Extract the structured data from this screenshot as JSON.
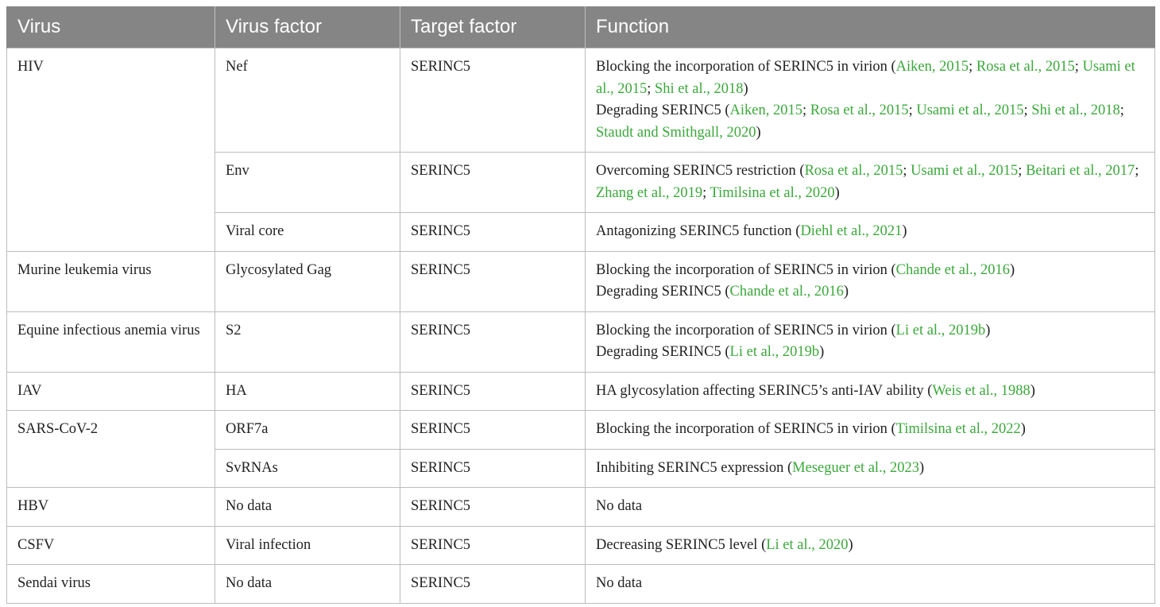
{
  "table": {
    "headers": [
      "Virus",
      "Virus factor",
      "Target factor",
      "Function"
    ],
    "rows": [
      {
        "virus": "HIV",
        "factor": "Nef",
        "target": "SERINC5",
        "function_lines": [
          [
            "Blocking the incorporation of SERINC5 in virion (",
            {
              "cite": "Aiken, 2015"
            },
            "; ",
            {
              "cite": "Rosa et al., 2015"
            },
            "; ",
            {
              "cite": "Usami et al., 2015"
            },
            "; ",
            {
              "cite": "Shi et al., 2018"
            },
            ")"
          ],
          [
            "Degrading SERINC5 (",
            {
              "cite": "Aiken, 2015"
            },
            "; ",
            {
              "cite": "Rosa et al., 2015"
            },
            "; ",
            {
              "cite": "Usami et al., 2015"
            },
            "; ",
            {
              "cite": "Shi et al., 2018"
            },
            "; ",
            {
              "cite": "Staudt and Smithgall, 2020"
            },
            ")"
          ]
        ]
      },
      {
        "virus": "",
        "factor": "Env",
        "target": "SERINC5",
        "function_lines": [
          [
            "Overcoming SERINC5 restriction (",
            {
              "cite": "Rosa et al., 2015"
            },
            "; ",
            {
              "cite": "Usami et al., 2015"
            },
            "; ",
            {
              "cite": "Beitari et al., 2017"
            },
            "; ",
            {
              "cite": "Zhang et al., 2019"
            },
            "; ",
            {
              "cite": "Timilsina et al., 2020"
            },
            ")"
          ]
        ]
      },
      {
        "virus": "",
        "factor": "Viral core",
        "target": "SERINC5",
        "function_lines": [
          [
            "Antagonizing SERINC5 function (",
            {
              "cite": "Diehl et al., 2021"
            },
            ")"
          ]
        ]
      },
      {
        "virus": "Murine leukemia virus",
        "factor": "Glycosylated Gag",
        "target": "SERINC5",
        "function_lines": [
          [
            "Blocking the incorporation of SERINC5 in virion (",
            {
              "cite": "Chande et al., 2016"
            },
            ")"
          ],
          [
            "Degrading SERINC5 (",
            {
              "cite": "Chande et al., 2016"
            },
            ")"
          ]
        ]
      },
      {
        "virus": "Equine infectious anemia virus",
        "factor": "S2",
        "target": "SERINC5",
        "function_lines": [
          [
            "Blocking the incorporation of SERINC5 in virion (",
            {
              "cite": "Li et al., 2019b"
            },
            ")"
          ],
          [
            "Degrading SERINC5 (",
            {
              "cite": "Li et al., 2019b"
            },
            ")"
          ]
        ]
      },
      {
        "virus": "IAV",
        "factor": "HA",
        "target": "SERINC5",
        "function_lines": [
          [
            "HA glycosylation affecting SERINC5’s anti-IAV ability (",
            {
              "cite": "Weis et al., 1988"
            },
            ")"
          ]
        ]
      },
      {
        "virus": "SARS-CoV-2",
        "factor": "ORF7a",
        "target": "SERINC5",
        "function_lines": [
          [
            "Blocking the incorporation of SERINC5 in virion (",
            {
              "cite": "Timilsina et al., 2022"
            },
            ")"
          ]
        ]
      },
      {
        "virus": "",
        "factor": "SvRNAs",
        "target": "SERINC5",
        "function_lines": [
          [
            "Inhibiting SERINC5 expression (",
            {
              "cite": "Meseguer et al., 2023"
            },
            ")"
          ]
        ]
      },
      {
        "virus": "HBV",
        "factor": "No data",
        "target": "SERINC5",
        "function_lines": [
          [
            "No data"
          ]
        ]
      },
      {
        "virus": "CSFV",
        "factor": "Viral infection",
        "target": "SERINC5",
        "function_lines": [
          [
            "Decreasing SERINC5 level (",
            {
              "cite": "Li et al., 2020"
            },
            ")"
          ]
        ]
      },
      {
        "virus": "Sendai virus",
        "factor": "No data",
        "target": "SERINC5",
        "function_lines": [
          [
            "No data"
          ]
        ]
      }
    ]
  },
  "colors": {
    "header_bg": "#858585",
    "header_text": "#ffffff",
    "citation": "#3aa83a",
    "border": "#bcbcbc"
  }
}
